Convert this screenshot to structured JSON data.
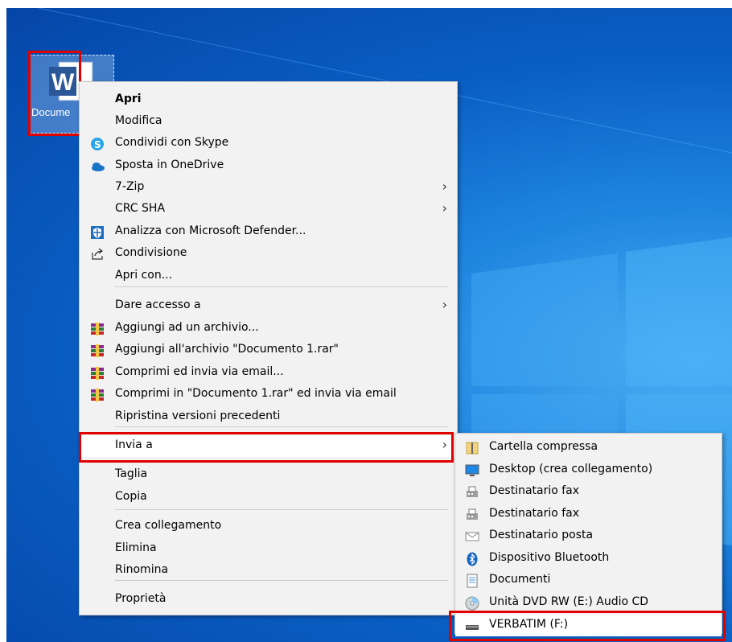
{
  "desktop": {
    "icon_label": "Docume",
    "icon_name": "word-document-icon"
  },
  "context_menu": {
    "items": [
      {
        "label": "Apri",
        "icon": "",
        "bold": true
      },
      {
        "label": "Modifica",
        "icon": ""
      },
      {
        "label": "Condividi con Skype",
        "icon": "skype-icon"
      },
      {
        "label": "Sposta in OneDrive",
        "icon": "onedrive-icon"
      },
      {
        "label": "7-Zip",
        "icon": "",
        "submenu": true
      },
      {
        "label": "CRC SHA",
        "icon": "",
        "submenu": true
      },
      {
        "label": "Analizza con Microsoft Defender...",
        "icon": "defender-icon"
      },
      {
        "label": "Condivisione",
        "icon": "share-icon"
      },
      {
        "label": "Apri con...",
        "icon": ""
      },
      {
        "label": "Dare accesso a",
        "icon": "",
        "submenu": true
      },
      {
        "label": "Aggiungi ad un archivio...",
        "icon": "winrar-icon"
      },
      {
        "label": "Aggiungi all'archivio \"Documento 1.rar\"",
        "icon": "winrar-icon"
      },
      {
        "label": "Comprimi ed invia via email...",
        "icon": "winrar-icon"
      },
      {
        "label": "Comprimi in \"Documento 1.rar\" ed invia via email",
        "icon": "winrar-icon"
      },
      {
        "label": "Ripristina versioni precedenti",
        "icon": ""
      },
      {
        "label": "Invia a",
        "icon": "",
        "submenu": true,
        "selected": true
      },
      {
        "label": "Taglia",
        "icon": ""
      },
      {
        "label": "Copia",
        "icon": ""
      },
      {
        "label": "Crea collegamento",
        "icon": ""
      },
      {
        "label": "Elimina",
        "icon": ""
      },
      {
        "label": "Rinomina",
        "icon": ""
      },
      {
        "label": "Proprietà",
        "icon": ""
      }
    ],
    "submenu_arrow": "›"
  },
  "send_to_menu": {
    "items": [
      {
        "label": "Cartella compressa",
        "icon": "zip-folder-icon"
      },
      {
        "label": "Desktop (crea collegamento)",
        "icon": "desktop-icon"
      },
      {
        "label": "Destinatario fax",
        "icon": "fax-icon"
      },
      {
        "label": "Destinatario fax",
        "icon": "fax-icon"
      },
      {
        "label": "Destinatario posta",
        "icon": "mail-icon"
      },
      {
        "label": "Dispositivo Bluetooth",
        "icon": "bluetooth-icon"
      },
      {
        "label": "Documenti",
        "icon": "documents-icon"
      },
      {
        "label": "Unità DVD RW (E:) Audio CD",
        "icon": "dvd-drive-icon"
      },
      {
        "label": "VERBATIM (F:)",
        "icon": "usb-drive-icon",
        "selected": true
      }
    ]
  },
  "colors": {
    "highlight": "#e00000",
    "menu_bg": "#f2f2f2",
    "desktop_blue": "#0a5fc4"
  }
}
